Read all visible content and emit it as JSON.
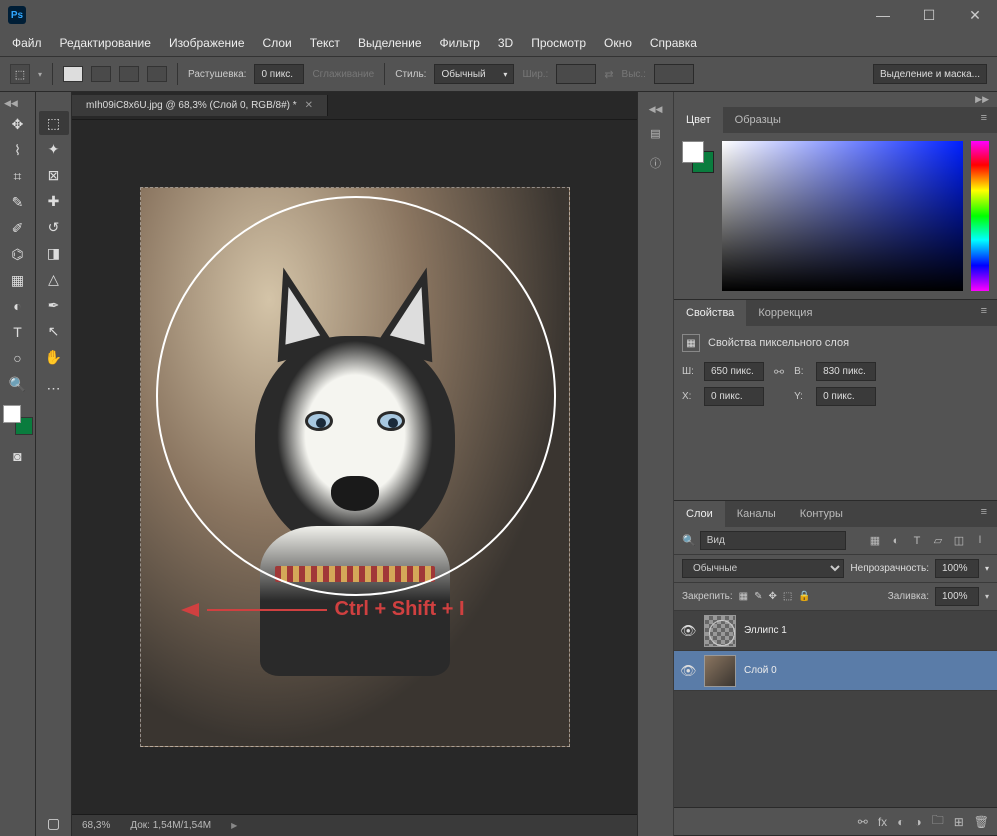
{
  "title_bar": {
    "app_abbr": "Ps"
  },
  "menu": {
    "file": "Файл",
    "edit": "Редактирование",
    "image": "Изображение",
    "layer": "Слои",
    "type": "Текст",
    "select": "Выделение",
    "filter": "Фильтр",
    "threed": "3D",
    "view": "Просмотр",
    "window": "Окно",
    "help": "Справка"
  },
  "options": {
    "feather_label": "Растушевка:",
    "feather_value": "0 пикс.",
    "antialias": "Сглаживание",
    "style_label": "Стиль:",
    "style_value": "Обычный",
    "width_label": "Шир.:",
    "height_label": "Выс.:",
    "select_mask": "Выделение и маска..."
  },
  "document": {
    "tab_title": "mIh09iC8x6U.jpg @ 68,3% (Слой 0, RGB/8#) *",
    "zoom": "68,3%",
    "doc_size": "Док: 1,54M/1,54M"
  },
  "annotation": {
    "text": "Ctrl + Shift + I"
  },
  "panels": {
    "color": {
      "tab_color": "Цвет",
      "tab_swatches": "Образцы"
    },
    "props": {
      "tab_props": "Свойства",
      "tab_adjust": "Коррекция",
      "pixel_layer": "Свойства пиксельного слоя",
      "w_label": "Ш:",
      "w_value": "650 пикс.",
      "h_label": "В:",
      "h_value": "830 пикс.",
      "x_label": "X:",
      "x_value": "0 пикс.",
      "y_label": "Y:",
      "y_value": "0 пикс."
    },
    "layers": {
      "tab_layers": "Слои",
      "tab_channels": "Каналы",
      "tab_paths": "Контуры",
      "search_placeholder": "Вид",
      "blend_mode": "Обычные",
      "opacity_label": "Непрозрачность:",
      "opacity_value": "100%",
      "lock_label": "Закрепить:",
      "fill_label": "Заливка:",
      "fill_value": "100%",
      "layer1": "Эллипс 1",
      "layer2": "Слой 0"
    }
  }
}
